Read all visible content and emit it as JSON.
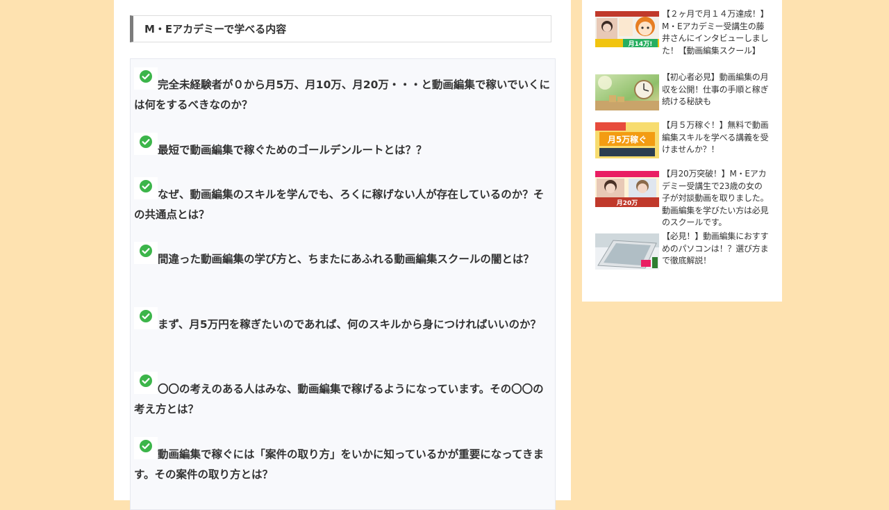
{
  "article": {
    "heading": "M・Eアカデミーで学べる内容",
    "items": [
      "完全未経験者が０から月5万、月10万、月20万・・・と動画編集で稼いでいくには何をするべきなのか？",
      "最短で動画編集で稼ぐためのゴールデンルートとは？？",
      "なぜ、動画編集のスキルを学んでも、ろくに稼げない人が存在しているのか？その共通点とは？",
      "間違った動画編集の学び方と、ちまたにあふれる動画編集スクールの闇とは？",
      "まず、月5万円を稼ぎたいのであれば、何のスキルから身につければいいのか？",
      "〇〇の考えのある人はみな、動画編集で稼げるようになっています。その〇〇の考え方とは？",
      "動画編集で稼ぐには「案件の取り方」をいかに知っているかが重要になってきます。その案件の取り方とは？"
    ],
    "check_icon": "check-circle-icon",
    "check_color": "#3cb54a"
  },
  "sidebar": {
    "posts": [
      {
        "title": "【２ヶ月で月１４万達成！】M・Eアカデミー受講生の藤井さんにインタビューしました！【動画編集スクール】",
        "thumb_text": "月14万!"
      },
      {
        "title": "【初心者必見】動画編集の月収を公開！仕事の手順と稼ぎ続ける秘訣も",
        "thumb_text": ""
      },
      {
        "title": "【月５万稼ぐ！】無料で動画編集スキルを学べる講義を受けませんか？！",
        "thumb_text": "月5万稼ぐ"
      },
      {
        "title": "【月20万突破！】M・Eアカデミー受講生で23歳の女の子が対談動画を取りました。動画編集を学びたい方は必見のスクールです。",
        "thumb_text": "月20万"
      },
      {
        "title": "【必見！】動画編集におすすめのパソコンは！？選び方まで徹底解説！",
        "thumb_text": ""
      }
    ]
  }
}
